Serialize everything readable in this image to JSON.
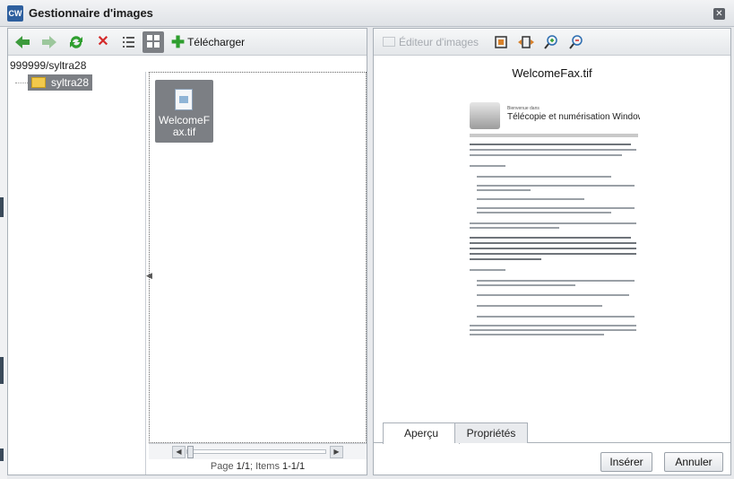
{
  "window": {
    "title": "Gestionnaire d'images",
    "app_icon": "CW"
  },
  "left_toolbar": {
    "icons": [
      "back-arrow-icon",
      "forward-arrow-icon",
      "refresh-icon",
      "delete-icon",
      "list-view-icon",
      "grid-view-icon"
    ],
    "upload_label": "Télécharger"
  },
  "path": "999999/syltra28",
  "tree": {
    "items": [
      {
        "label": "syltra28"
      }
    ]
  },
  "files": {
    "items": [
      {
        "name": "WelcomeFax.tif"
      }
    ]
  },
  "pager": {
    "page_word": "Page",
    "page_value": "1/1",
    "items_word": "; Items",
    "items_value": "1-1/1"
  },
  "right_toolbar": {
    "editor_label": "Éditeur d'images",
    "icons": [
      "fit-to-page-icon",
      "fit-width-icon",
      "zoom-in-icon",
      "zoom-out-icon"
    ]
  },
  "preview": {
    "filename": "WelcomeFax.tif",
    "doc_heading_small": "Bienvenue dans",
    "doc_heading": "Télécopie et numérisation Windows"
  },
  "tabs": [
    {
      "label": "Aperçu",
      "active": true
    },
    {
      "label": "Propriétés",
      "active": false
    }
  ],
  "buttons": {
    "insert": "Insérer",
    "cancel": "Annuler"
  },
  "colors": {
    "accent_green": "#2e9e2e",
    "delete_red": "#d42a2a",
    "selection_gray": "#7c7f84"
  }
}
